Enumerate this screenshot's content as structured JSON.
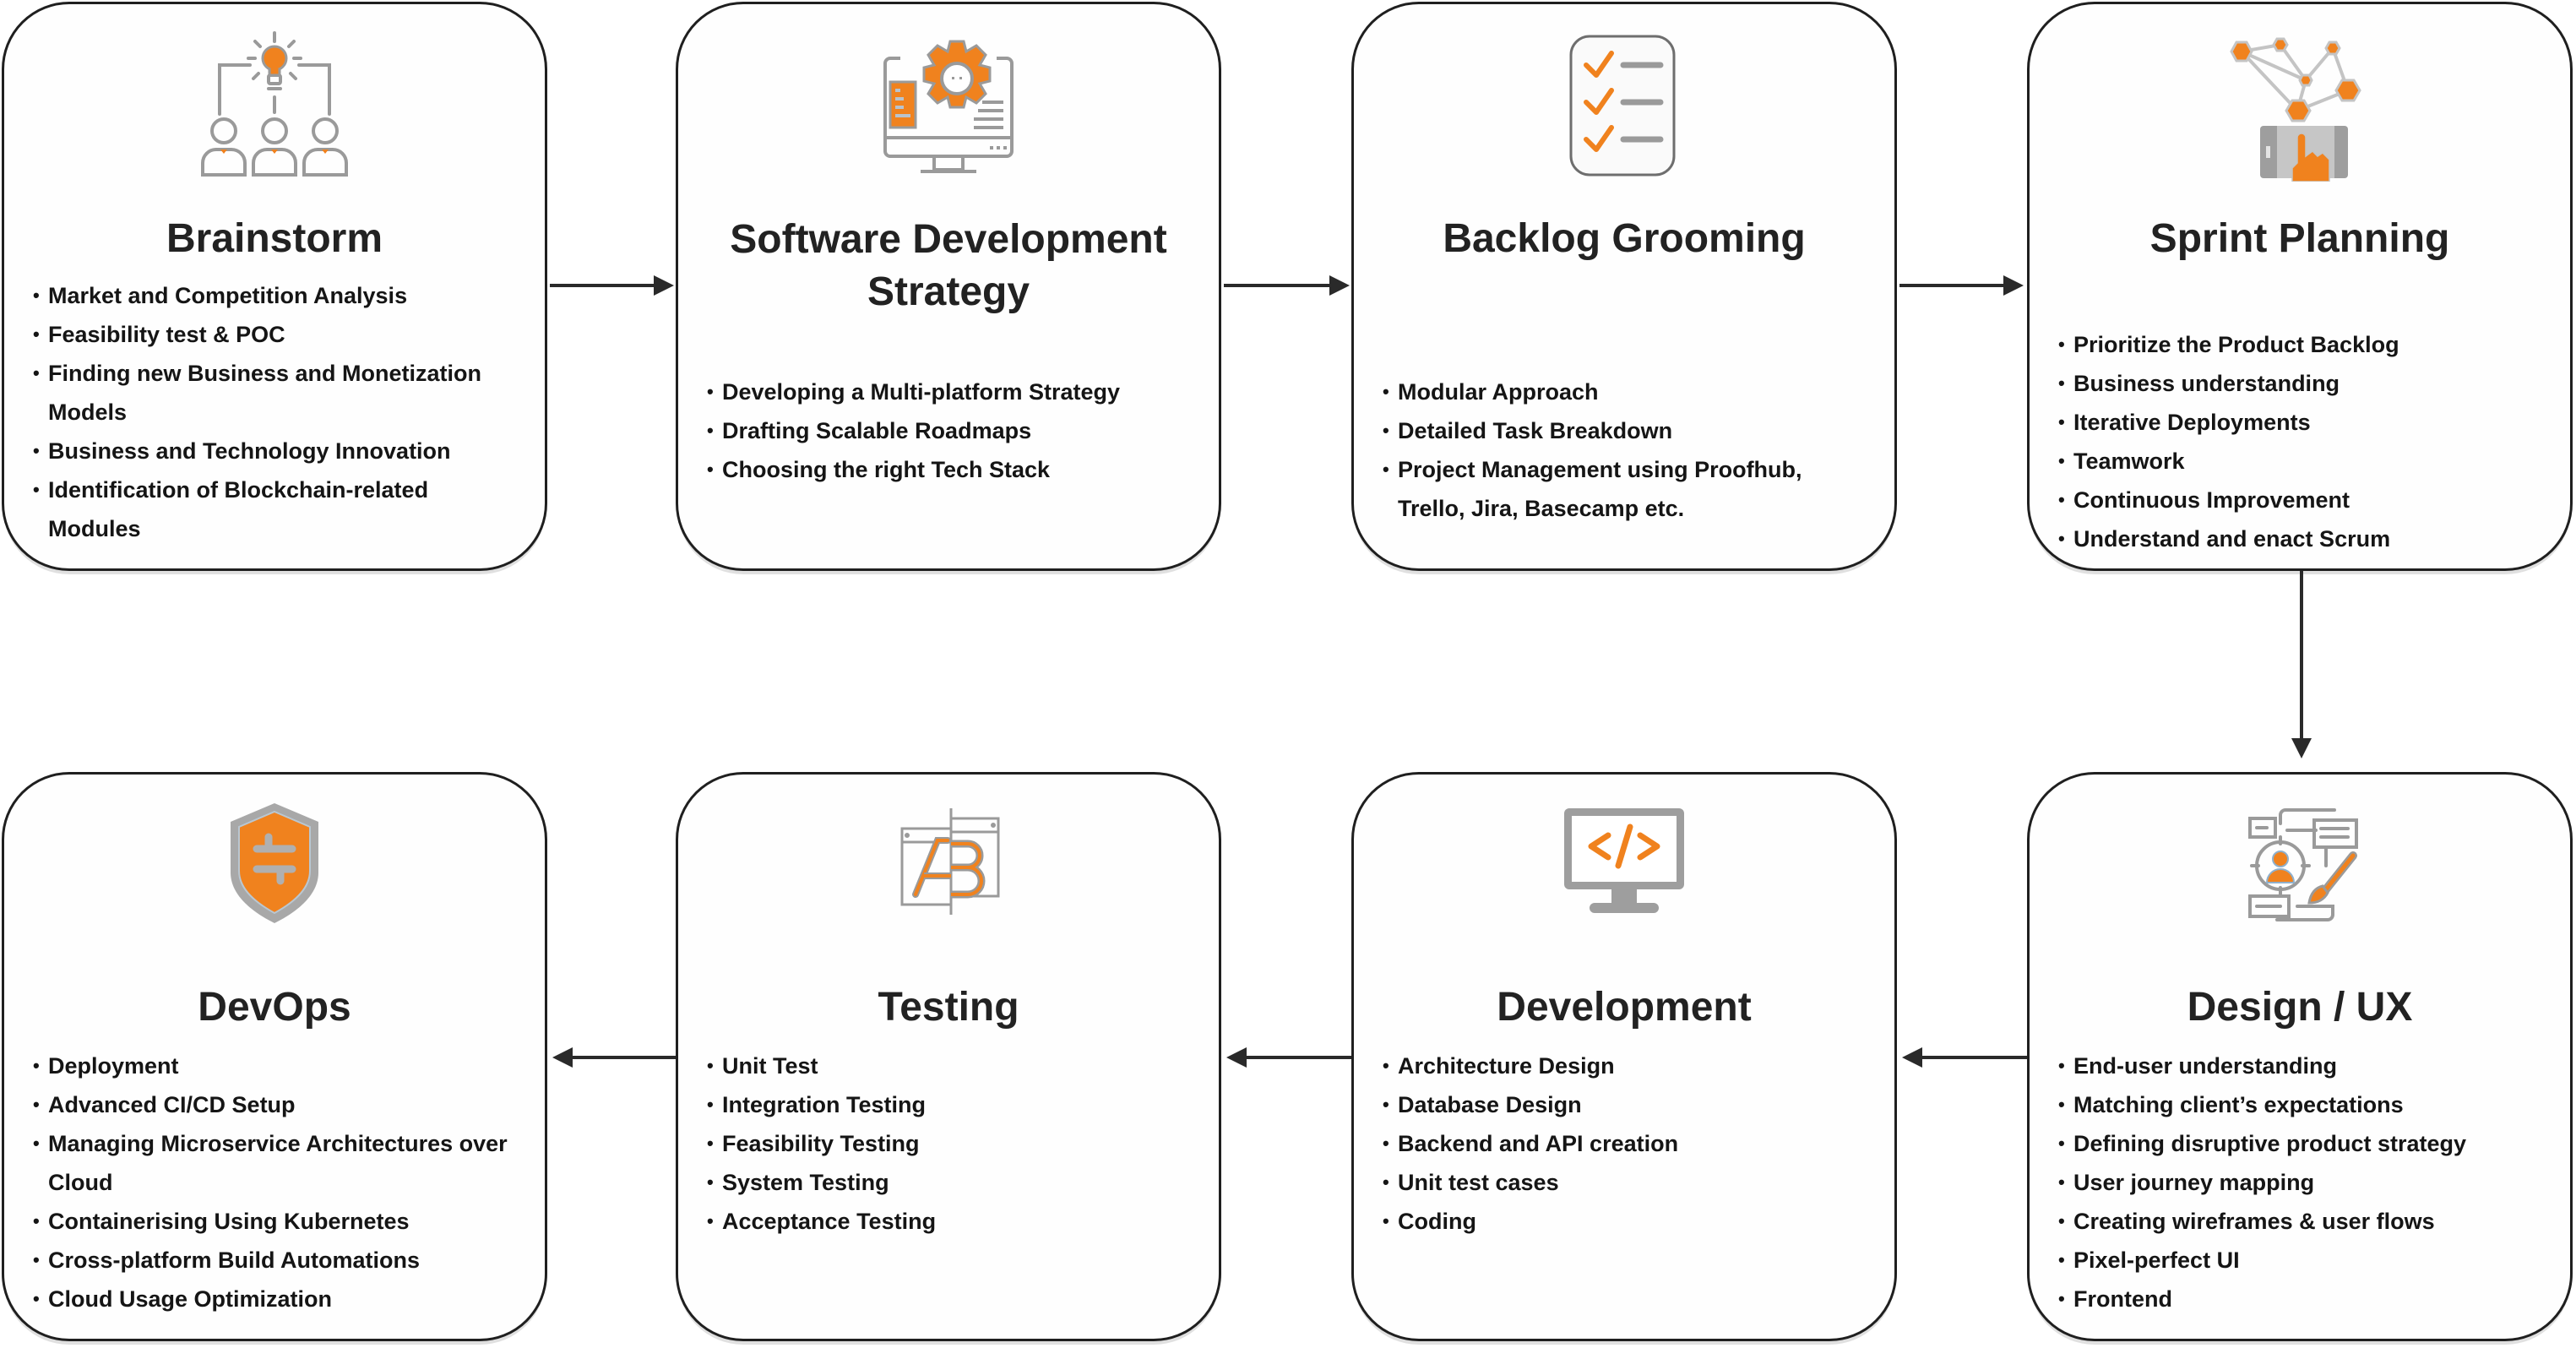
{
  "colors": {
    "accent": "#F0821E",
    "icon_gray": "#9A9A9A",
    "border": "#1f1f1f",
    "text": "#1e1e1e"
  },
  "steps": [
    {
      "title": "Brainstorm",
      "icon": "brainstorm-team-lightbulb-icon",
      "bullets": [
        "Market and Competition Analysis",
        "Feasibility test & POC",
        "Finding new Business and Monetization Models",
        "Business and Technology Innovation",
        "Identification of Blockchain-related Modules"
      ]
    },
    {
      "title": "Software Development Strategy",
      "title_lines": [
        "Software Development",
        "Strategy"
      ],
      "icon": "monitor-gear-icon",
      "bullets": [
        "Developing a Multi-platform Strategy",
        "Drafting Scalable Roadmaps",
        "Choosing the right Tech Stack"
      ]
    },
    {
      "title": "Backlog Grooming",
      "icon": "checklist-icon",
      "bullets": [
        "Modular Approach",
        "Detailed Task Breakdown",
        "Project Management using Proofhub, Trello, Jira, Basecamp etc."
      ]
    },
    {
      "title": "Sprint Planning",
      "icon": "tablet-network-touch-icon",
      "bullets": [
        "Prioritize the Product Backlog",
        "Business understanding",
        "Iterative Deployments",
        "Teamwork",
        "Continuous Improvement",
        "Understand and enact Scrum"
      ]
    },
    {
      "title": "Design / UX",
      "icon": "user-target-paintbrush-icon",
      "bullets": [
        "End-user understanding",
        "Matching client’s expectations",
        "Defining disruptive product strategy",
        "User journey mapping",
        "Creating wireframes & user flows",
        "Pixel-perfect UI",
        "Frontend"
      ]
    },
    {
      "title": "Development",
      "icon": "monitor-code-icon",
      "bullets": [
        "Architecture Design",
        "Database Design",
        "Backend and API creation",
        "Unit test cases",
        "Coding"
      ]
    },
    {
      "title": "Testing",
      "icon": "ab-testing-icon",
      "bullets": [
        "Unit Test",
        "Integration Testing",
        "Feasibility Testing",
        "System Testing",
        "Acceptance Testing"
      ]
    },
    {
      "title": "DevOps",
      "icon": "shield-devops-icon",
      "bullets": [
        "Deployment",
        "Advanced CI/CD Setup",
        "Managing Microservice Architectures over Cloud",
        "Containerising Using Kubernetes",
        "Cross-platform Build Automations",
        "Cloud Usage Optimization"
      ]
    }
  ],
  "flow": [
    {
      "from": "Brainstorm",
      "to": "Software Development Strategy",
      "direction": "right"
    },
    {
      "from": "Software Development Strategy",
      "to": "Backlog Grooming",
      "direction": "right"
    },
    {
      "from": "Backlog Grooming",
      "to": "Sprint Planning",
      "direction": "right"
    },
    {
      "from": "Sprint Planning",
      "to": "Design / UX",
      "direction": "down"
    },
    {
      "from": "Design / UX",
      "to": "Development",
      "direction": "left"
    },
    {
      "from": "Development",
      "to": "Testing",
      "direction": "left"
    },
    {
      "from": "Testing",
      "to": "DevOps",
      "direction": "left"
    }
  ]
}
